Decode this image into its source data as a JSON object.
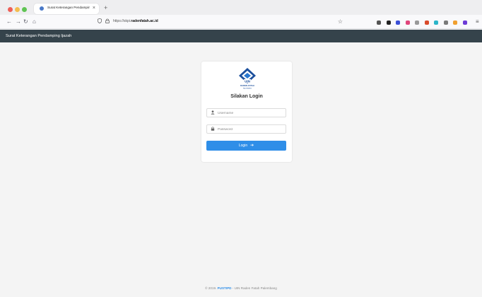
{
  "browser": {
    "tab_title": "Surat Keterangan Pendamping Ijazah",
    "tab_close": "×",
    "new_tab": "+",
    "nav": {
      "back": "←",
      "forward": "→",
      "reload": "↻",
      "home": "⌂"
    },
    "url_prefix": "https://skpi.",
    "url_domain": "radenfatah.ac.id",
    "extension_colors": [
      "#555555",
      "#222222",
      "#3a4fd6",
      "#e0457b",
      "#999999",
      "#d94b2b",
      "#2bb5c9",
      "#7a7a7a",
      "#f0a030",
      "#6c3bd6"
    ],
    "menu": "≡"
  },
  "header": {
    "title": "Surat Keterangan Pendamping Ijazah"
  },
  "login": {
    "title": "Silakan Login",
    "logo_text": "UIN",
    "logo_subtext": "RADEN FATAH",
    "logo_subtext2": "PALEMBANG",
    "username_placeholder": "Username",
    "password_placeholder": "Password",
    "button_label": "Login",
    "colors": {
      "button": "#2f8ee8",
      "logo": "#1c4f9c"
    }
  },
  "footer": {
    "prefix": "© 2019.",
    "link": "PUSTIPD",
    "suffix": "- UIN Raden Fatah Palembang"
  }
}
